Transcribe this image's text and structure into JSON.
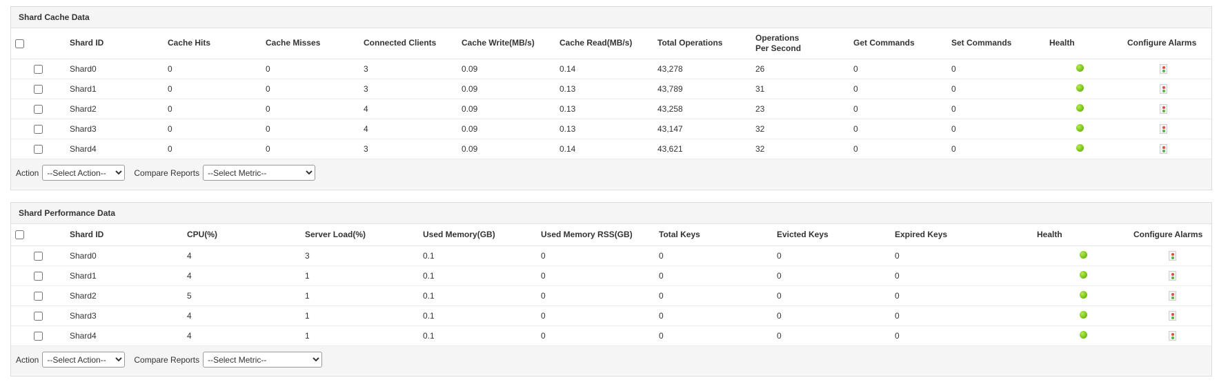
{
  "cache_panel": {
    "title": "Shard Cache Data",
    "columns": [
      "Shard ID",
      "Cache Hits",
      "Cache Misses",
      "Connected Clients",
      "Cache Write(MB/s)",
      "Cache Read(MB/s)",
      "Total Operations",
      "Operations Per Second",
      "Get Commands",
      "Set Commands",
      "Health",
      "Configure Alarms"
    ],
    "rows": [
      [
        "Shard0",
        "0",
        "0",
        "3",
        "0.09",
        "0.14",
        "43,278",
        "26",
        "0",
        "0"
      ],
      [
        "Shard1",
        "0",
        "0",
        "3",
        "0.09",
        "0.13",
        "43,789",
        "31",
        "0",
        "0"
      ],
      [
        "Shard2",
        "0",
        "0",
        "4",
        "0.09",
        "0.13",
        "43,258",
        "23",
        "0",
        "0"
      ],
      [
        "Shard3",
        "0",
        "0",
        "4",
        "0.09",
        "0.13",
        "43,147",
        "32",
        "0",
        "0"
      ],
      [
        "Shard4",
        "0",
        "0",
        "3",
        "0.09",
        "0.14",
        "43,621",
        "32",
        "0",
        "0"
      ]
    ],
    "action_label": "Action",
    "action_selected": "--Select Action--",
    "compare_label": "Compare Reports",
    "compare_selected": "--Select Metric--"
  },
  "perf_panel": {
    "title": "Shard Performance Data",
    "columns": [
      "Shard ID",
      "CPU(%)",
      "Server Load(%)",
      "Used Memory(GB)",
      "Used Memory RSS(GB)",
      "Total Keys",
      "Evicted Keys",
      "Expired Keys",
      "Health",
      "Configure Alarms"
    ],
    "rows": [
      [
        "Shard0",
        "4",
        "3",
        "0.1",
        "0",
        "0",
        "0",
        "0"
      ],
      [
        "Shard1",
        "4",
        "1",
        "0.1",
        "0",
        "0",
        "0",
        "0"
      ],
      [
        "Shard2",
        "5",
        "1",
        "0.1",
        "0",
        "0",
        "0",
        "0"
      ],
      [
        "Shard3",
        "4",
        "1",
        "0.1",
        "0",
        "0",
        "0",
        "0"
      ],
      [
        "Shard4",
        "4",
        "1",
        "0.1",
        "0",
        "0",
        "0",
        "0"
      ]
    ],
    "action_label": "Action",
    "action_selected": "--Select Action--",
    "compare_label": "Compare Reports",
    "compare_selected": "--Select Metric--"
  },
  "icons": {
    "health": "health-status-dot-icon",
    "alarm": "configure-alarm-icon"
  },
  "colors": {
    "health_ok": "#7cc61c",
    "alarm_red": "#e24a3b",
    "alarm_green": "#56b33a"
  }
}
